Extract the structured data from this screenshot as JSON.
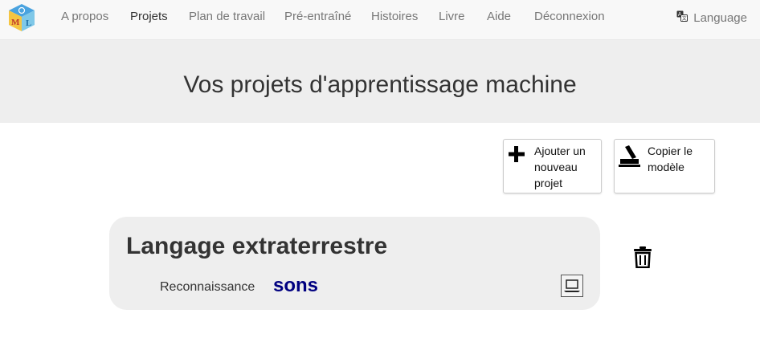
{
  "navbar": {
    "logo_name": "mlforkids-logo",
    "items": [
      {
        "label": "A propos",
        "active": false
      },
      {
        "label": "Projets",
        "active": true
      },
      {
        "label": "Plan de travail",
        "active": false
      },
      {
        "label": "Pré-entraîné",
        "active": false
      },
      {
        "label": "Histoires",
        "active": false
      },
      {
        "label": "Livre",
        "active": false
      },
      {
        "label": "Aide",
        "active": false
      },
      {
        "label": "Déconnexion",
        "active": false
      }
    ],
    "language_label": "Language"
  },
  "header": {
    "title": "Vos projets d'apprentissage machine"
  },
  "actions": {
    "add_label": "Ajouter un nouveau projet",
    "copy_label": "Copier le modèle"
  },
  "project": {
    "title": "Langage extraterrestre",
    "type_label": "Reconnaissance",
    "mode_label": "sons",
    "storage_icon": "laptop-icon"
  },
  "colors": {
    "navbar_bg": "#f8f8f8",
    "jumbotron_bg": "#eeeeee",
    "card_bg": "#eeeeee",
    "mode_text": "#000080"
  }
}
